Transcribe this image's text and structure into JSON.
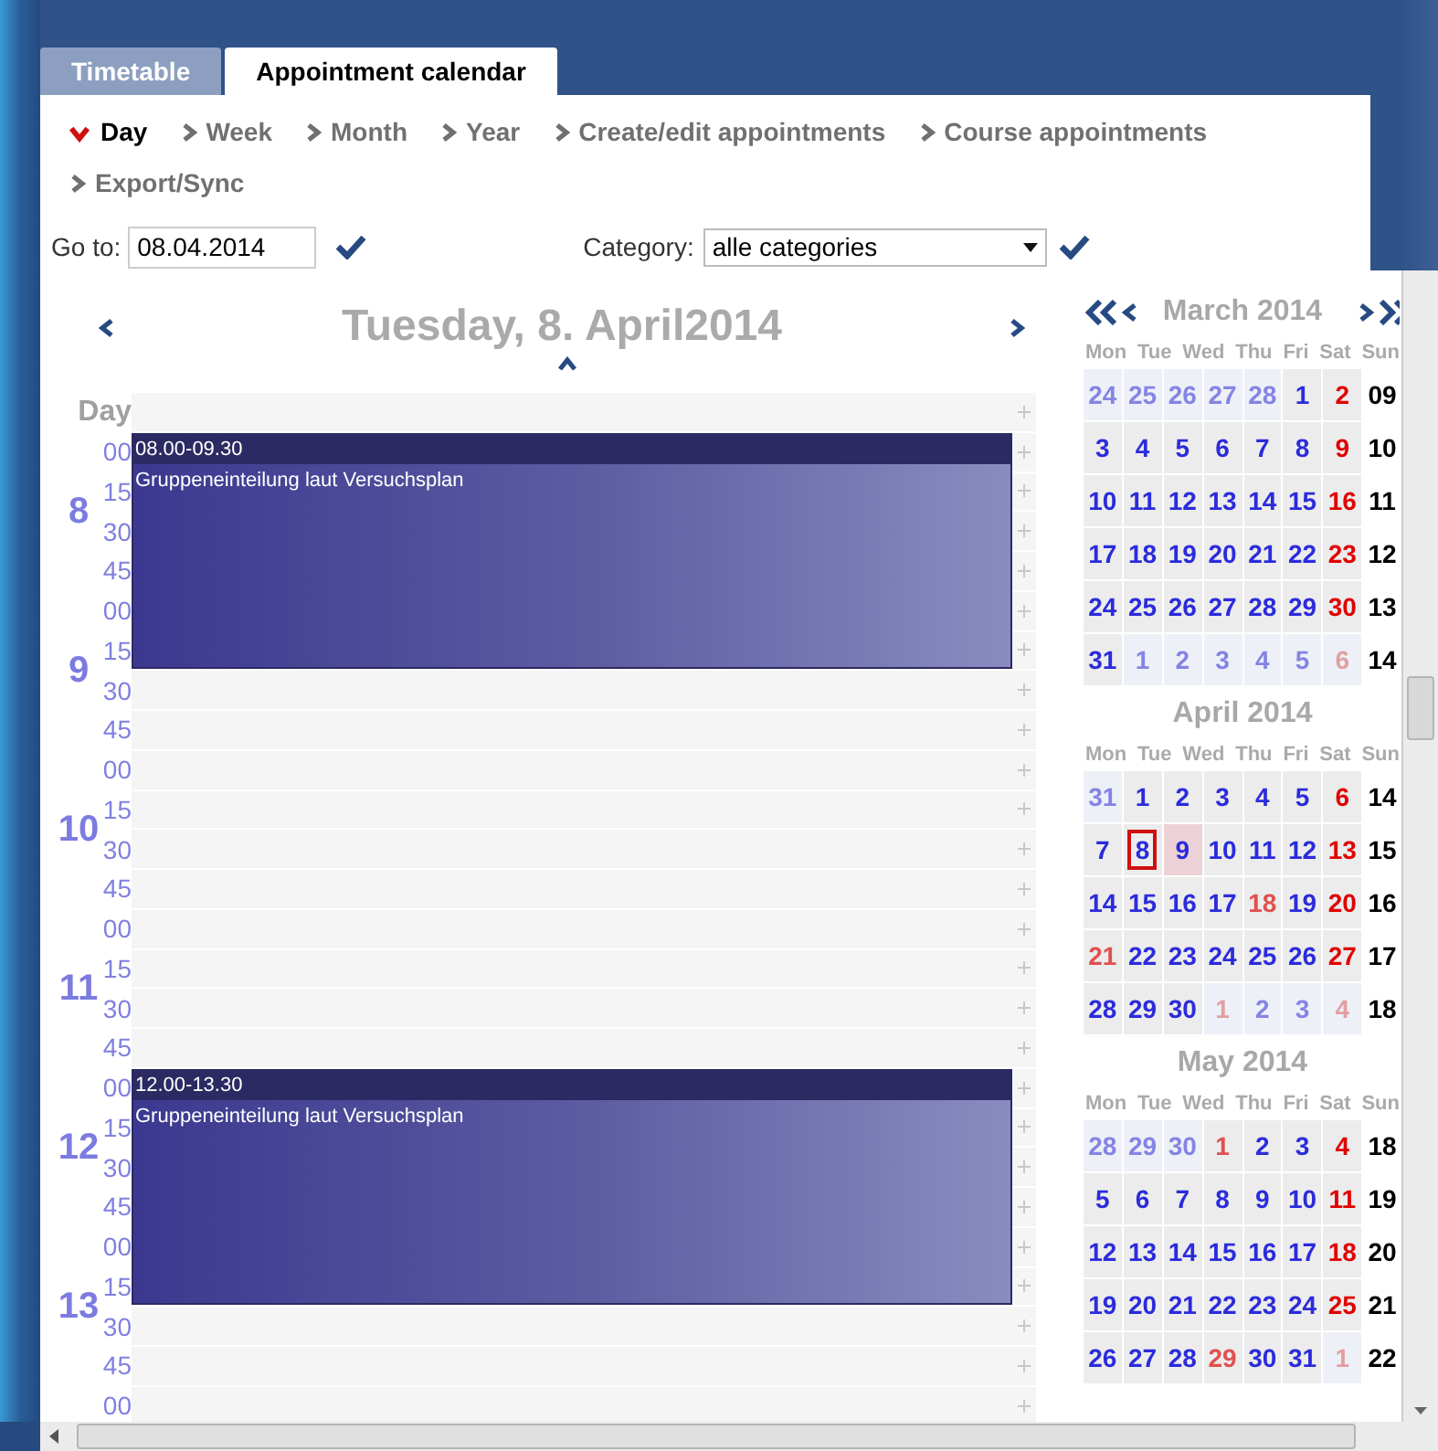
{
  "tabs": [
    {
      "label": "Timetable",
      "selected": false
    },
    {
      "label": "Appointment calendar",
      "selected": true
    }
  ],
  "views": [
    {
      "label": "Day",
      "selected": true
    },
    {
      "label": "Week",
      "selected": false
    },
    {
      "label": "Month",
      "selected": false
    },
    {
      "label": "Year",
      "selected": false
    },
    {
      "label": "Create/edit appointments",
      "selected": false
    },
    {
      "label": "Course appointments",
      "selected": false
    },
    {
      "label": "Export/Sync",
      "selected": false
    }
  ],
  "goto": {
    "label": "Go to:",
    "value": "08.04.2014"
  },
  "category": {
    "label": "Category:",
    "value": "alle categories"
  },
  "day_view": {
    "title": "Tuesday, 8. April2014",
    "header": "Day",
    "hours": [
      {
        "hour": "8",
        "slots": [
          {
            "minute": "00",
            "busy": true,
            "event": {
              "time": "08.00-09.30",
              "title": "Gruppeneinteilung laut Versuchsplan"
            }
          },
          {
            "minute": "15",
            "busy": true
          },
          {
            "minute": "30",
            "busy": true
          },
          {
            "minute": "45",
            "busy": true
          }
        ]
      },
      {
        "hour": "9",
        "slots": [
          {
            "minute": "00",
            "busy": true
          },
          {
            "minute": "15",
            "busy": true
          },
          {
            "minute": "30",
            "busy": false
          },
          {
            "minute": "45",
            "busy": false
          }
        ]
      },
      {
        "hour": "10",
        "slots": [
          {
            "minute": "00",
            "busy": false
          },
          {
            "minute": "15",
            "busy": false
          },
          {
            "minute": "30",
            "busy": false
          },
          {
            "minute": "45",
            "busy": false
          }
        ]
      },
      {
        "hour": "11",
        "slots": [
          {
            "minute": "00",
            "busy": false
          },
          {
            "minute": "15",
            "busy": false
          },
          {
            "minute": "30",
            "busy": false
          },
          {
            "minute": "45",
            "busy": false
          }
        ]
      },
      {
        "hour": "12",
        "slots": [
          {
            "minute": "00",
            "busy": true,
            "event": {
              "time": "12.00-13.30",
              "title": "Gruppeneinteilung laut Versuchsplan"
            }
          },
          {
            "minute": "15",
            "busy": true
          },
          {
            "minute": "30",
            "busy": true
          },
          {
            "minute": "45",
            "busy": true
          }
        ]
      },
      {
        "hour": "13",
        "slots": [
          {
            "minute": "00",
            "busy": true
          },
          {
            "minute": "15",
            "busy": true
          },
          {
            "minute": "30",
            "busy": false
          },
          {
            "minute": "45",
            "busy": false
          }
        ]
      },
      {
        "slots": [
          {
            "minute": "00",
            "busy": false
          }
        ]
      }
    ]
  },
  "months": [
    {
      "title": "March 2014",
      "nav": true,
      "weekdays": [
        "Mon",
        "Tue",
        "Wed",
        "Thu",
        "Fri",
        "Sat",
        "Sun"
      ],
      "weeks": [
        {
          "week": "09",
          "days": [
            {
              "day": "24",
              "kind": "other",
              "selected": false,
              "today": false
            },
            {
              "day": "25",
              "kind": "other",
              "selected": false,
              "today": false
            },
            {
              "day": "26",
              "kind": "other",
              "selected": false,
              "today": false
            },
            {
              "day": "27",
              "kind": "other",
              "selected": false,
              "today": false
            },
            {
              "day": "28",
              "kind": "other",
              "selected": false,
              "today": false
            },
            {
              "day": "1",
              "kind": "day",
              "selected": false,
              "today": false
            },
            {
              "day": "2",
              "kind": "sunday",
              "selected": false,
              "today": false
            }
          ]
        },
        {
          "week": "10",
          "days": [
            {
              "day": "3",
              "kind": "day",
              "selected": false,
              "today": false
            },
            {
              "day": "4",
              "kind": "day",
              "selected": false,
              "today": false
            },
            {
              "day": "5",
              "kind": "day",
              "selected": false,
              "today": false
            },
            {
              "day": "6",
              "kind": "day",
              "selected": false,
              "today": false
            },
            {
              "day": "7",
              "kind": "day",
              "selected": false,
              "today": false
            },
            {
              "day": "8",
              "kind": "day",
              "selected": false,
              "today": false
            },
            {
              "day": "9",
              "kind": "sunday",
              "selected": false,
              "today": false
            }
          ]
        },
        {
          "week": "11",
          "days": [
            {
              "day": "10",
              "kind": "day",
              "selected": false,
              "today": false
            },
            {
              "day": "11",
              "kind": "day",
              "selected": false,
              "today": false
            },
            {
              "day": "12",
              "kind": "day",
              "selected": false,
              "today": false
            },
            {
              "day": "13",
              "kind": "day",
              "selected": false,
              "today": false
            },
            {
              "day": "14",
              "kind": "day",
              "selected": false,
              "today": false
            },
            {
              "day": "15",
              "kind": "day",
              "selected": false,
              "today": false
            },
            {
              "day": "16",
              "kind": "sunday",
              "selected": false,
              "today": false
            }
          ]
        },
        {
          "week": "12",
          "days": [
            {
              "day": "17",
              "kind": "day",
              "selected": false,
              "today": false
            },
            {
              "day": "18",
              "kind": "day",
              "selected": false,
              "today": false
            },
            {
              "day": "19",
              "kind": "day",
              "selected": false,
              "today": false
            },
            {
              "day": "20",
              "kind": "day",
              "selected": false,
              "today": false
            },
            {
              "day": "21",
              "kind": "day",
              "selected": false,
              "today": false
            },
            {
              "day": "22",
              "kind": "day",
              "selected": false,
              "today": false
            },
            {
              "day": "23",
              "kind": "sunday",
              "selected": false,
              "today": false
            }
          ]
        },
        {
          "week": "13",
          "days": [
            {
              "day": "24",
              "kind": "day",
              "selected": false,
              "today": false
            },
            {
              "day": "25",
              "kind": "day",
              "selected": false,
              "today": false
            },
            {
              "day": "26",
              "kind": "day",
              "selected": false,
              "today": false
            },
            {
              "day": "27",
              "kind": "day",
              "selected": false,
              "today": false
            },
            {
              "day": "28",
              "kind": "day",
              "selected": false,
              "today": false
            },
            {
              "day": "29",
              "kind": "day",
              "selected": false,
              "today": false
            },
            {
              "day": "30",
              "kind": "sunday",
              "selected": false,
              "today": false
            }
          ]
        },
        {
          "week": "14",
          "days": [
            {
              "day": "31",
              "kind": "day",
              "selected": false,
              "today": false
            },
            {
              "day": "1",
              "kind": "other",
              "selected": false,
              "today": false
            },
            {
              "day": "2",
              "kind": "other",
              "selected": false,
              "today": false
            },
            {
              "day": "3",
              "kind": "other",
              "selected": false,
              "today": false
            },
            {
              "day": "4",
              "kind": "other",
              "selected": false,
              "today": false
            },
            {
              "day": "5",
              "kind": "other",
              "selected": false,
              "today": false
            },
            {
              "day": "6",
              "kind": "other_sunday",
              "selected": false,
              "today": false
            }
          ]
        }
      ]
    },
    {
      "title": "April 2014",
      "nav": false,
      "weekdays": [
        "Mon",
        "Tue",
        "Wed",
        "Thu",
        "Fri",
        "Sat",
        "Sun"
      ],
      "weeks": [
        {
          "week": "14",
          "days": [
            {
              "day": "31",
              "kind": "other",
              "selected": false,
              "today": false
            },
            {
              "day": "1",
              "kind": "day",
              "selected": false,
              "today": false
            },
            {
              "day": "2",
              "kind": "day",
              "selected": false,
              "today": false
            },
            {
              "day": "3",
              "kind": "day",
              "selected": false,
              "today": false
            },
            {
              "day": "4",
              "kind": "day",
              "selected": false,
              "today": false
            },
            {
              "day": "5",
              "kind": "day",
              "selected": false,
              "today": false
            },
            {
              "day": "6",
              "kind": "sunday",
              "selected": false,
              "today": false
            }
          ]
        },
        {
          "week": "15",
          "days": [
            {
              "day": "7",
              "kind": "day",
              "selected": false,
              "today": false
            },
            {
              "day": "8",
              "kind": "day",
              "selected": true,
              "today": false
            },
            {
              "day": "9",
              "kind": "day",
              "selected": false,
              "today": true
            },
            {
              "day": "10",
              "kind": "day",
              "selected": false,
              "today": false
            },
            {
              "day": "11",
              "kind": "day",
              "selected": false,
              "today": false
            },
            {
              "day": "12",
              "kind": "day",
              "selected": false,
              "today": false
            },
            {
              "day": "13",
              "kind": "sunday",
              "selected": false,
              "today": false
            }
          ]
        },
        {
          "week": "16",
          "days": [
            {
              "day": "14",
              "kind": "day",
              "selected": false,
              "today": false
            },
            {
              "day": "15",
              "kind": "day",
              "selected": false,
              "today": false
            },
            {
              "day": "16",
              "kind": "day",
              "selected": false,
              "today": false
            },
            {
              "day": "17",
              "kind": "day",
              "selected": false,
              "today": false
            },
            {
              "day": "18",
              "kind": "holiday",
              "selected": false,
              "today": false
            },
            {
              "day": "19",
              "kind": "day",
              "selected": false,
              "today": false
            },
            {
              "day": "20",
              "kind": "sunday",
              "selected": false,
              "today": false
            }
          ]
        },
        {
          "week": "17",
          "days": [
            {
              "day": "21",
              "kind": "holiday",
              "selected": false,
              "today": false
            },
            {
              "day": "22",
              "kind": "day",
              "selected": false,
              "today": false
            },
            {
              "day": "23",
              "kind": "day",
              "selected": false,
              "today": false
            },
            {
              "day": "24",
              "kind": "day",
              "selected": false,
              "today": false
            },
            {
              "day": "25",
              "kind": "day",
              "selected": false,
              "today": false
            },
            {
              "day": "26",
              "kind": "day",
              "selected": false,
              "today": false
            },
            {
              "day": "27",
              "kind": "sunday",
              "selected": false,
              "today": false
            }
          ]
        },
        {
          "week": "18",
          "days": [
            {
              "day": "28",
              "kind": "day",
              "selected": false,
              "today": false
            },
            {
              "day": "29",
              "kind": "day",
              "selected": false,
              "today": false
            },
            {
              "day": "30",
              "kind": "day",
              "selected": false,
              "today": false
            },
            {
              "day": "1",
              "kind": "other_sunday",
              "selected": false,
              "today": false
            },
            {
              "day": "2",
              "kind": "other",
              "selected": false,
              "today": false
            },
            {
              "day": "3",
              "kind": "other",
              "selected": false,
              "today": false
            },
            {
              "day": "4",
              "kind": "other_sunday",
              "selected": false,
              "today": false
            }
          ]
        }
      ]
    },
    {
      "title": "May 2014",
      "nav": false,
      "weekdays": [
        "Mon",
        "Tue",
        "Wed",
        "Thu",
        "Fri",
        "Sat",
        "Sun"
      ],
      "weeks": [
        {
          "week": "18",
          "days": [
            {
              "day": "28",
              "kind": "other",
              "selected": false,
              "today": false
            },
            {
              "day": "29",
              "kind": "other",
              "selected": false,
              "today": false
            },
            {
              "day": "30",
              "kind": "other",
              "selected": false,
              "today": false
            },
            {
              "day": "1",
              "kind": "holiday",
              "selected": false,
              "today": false
            },
            {
              "day": "2",
              "kind": "day",
              "selected": false,
              "today": false
            },
            {
              "day": "3",
              "kind": "day",
              "selected": false,
              "today": false
            },
            {
              "day": "4",
              "kind": "sunday",
              "selected": false,
              "today": false
            }
          ]
        },
        {
          "week": "19",
          "days": [
            {
              "day": "5",
              "kind": "day",
              "selected": false,
              "today": false
            },
            {
              "day": "6",
              "kind": "day",
              "selected": false,
              "today": false
            },
            {
              "day": "7",
              "kind": "day",
              "selected": false,
              "today": false
            },
            {
              "day": "8",
              "kind": "day",
              "selected": false,
              "today": false
            },
            {
              "day": "9",
              "kind": "day",
              "selected": false,
              "today": false
            },
            {
              "day": "10",
              "kind": "day",
              "selected": false,
              "today": false
            },
            {
              "day": "11",
              "kind": "sunday",
              "selected": false,
              "today": false
            }
          ]
        },
        {
          "week": "20",
          "days": [
            {
              "day": "12",
              "kind": "day",
              "selected": false,
              "today": false
            },
            {
              "day": "13",
              "kind": "day",
              "selected": false,
              "today": false
            },
            {
              "day": "14",
              "kind": "day",
              "selected": false,
              "today": false
            },
            {
              "day": "15",
              "kind": "day",
              "selected": false,
              "today": false
            },
            {
              "day": "16",
              "kind": "day",
              "selected": false,
              "today": false
            },
            {
              "day": "17",
              "kind": "day",
              "selected": false,
              "today": false
            },
            {
              "day": "18",
              "kind": "sunday",
              "selected": false,
              "today": false
            }
          ]
        },
        {
          "week": "21",
          "days": [
            {
              "day": "19",
              "kind": "day",
              "selected": false,
              "today": false
            },
            {
              "day": "20",
              "kind": "day",
              "selected": false,
              "today": false
            },
            {
              "day": "21",
              "kind": "day",
              "selected": false,
              "today": false
            },
            {
              "day": "22",
              "kind": "day",
              "selected": false,
              "today": false
            },
            {
              "day": "23",
              "kind": "day",
              "selected": false,
              "today": false
            },
            {
              "day": "24",
              "kind": "day",
              "selected": false,
              "today": false
            },
            {
              "day": "25",
              "kind": "sunday",
              "selected": false,
              "today": false
            }
          ]
        },
        {
          "week": "22",
          "days": [
            {
              "day": "26",
              "kind": "day",
              "selected": false,
              "today": false
            },
            {
              "day": "27",
              "kind": "day",
              "selected": false,
              "today": false
            },
            {
              "day": "28",
              "kind": "day",
              "selected": false,
              "today": false
            },
            {
              "day": "29",
              "kind": "holiday",
              "selected": false,
              "today": false
            },
            {
              "day": "30",
              "kind": "day",
              "selected": false,
              "today": false
            },
            {
              "day": "31",
              "kind": "day",
              "selected": false,
              "today": false
            },
            {
              "day": "1",
              "kind": "other_sunday",
              "selected": false,
              "today": false
            }
          ]
        }
      ]
    }
  ]
}
